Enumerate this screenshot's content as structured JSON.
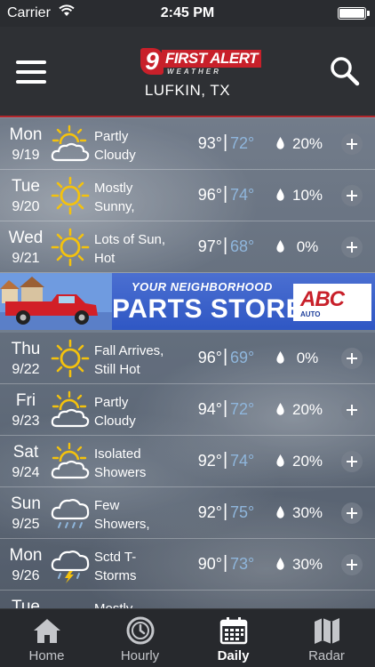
{
  "status_bar": {
    "carrier": "Carrier",
    "time": "2:45 PM"
  },
  "header": {
    "logo": {
      "number": "9",
      "text": "FIRST ALERT",
      "subtext": "WEATHER"
    },
    "location": "LUFKIN, TX"
  },
  "forecast": [
    {
      "day": "Mon",
      "date": "9/19",
      "icon": "partly-cloudy-icon",
      "desc1": "Partly",
      "desc2": "Cloudy",
      "hi": "93°",
      "lo": "72°",
      "precip": "20%"
    },
    {
      "day": "Tue",
      "date": "9/20",
      "icon": "sunny-icon",
      "desc1": "Mostly",
      "desc2": "Sunny,",
      "hi": "96°",
      "lo": "74°",
      "precip": "10%"
    },
    {
      "day": "Wed",
      "date": "9/21",
      "icon": "sunny-icon",
      "desc1": "Lots of Sun,",
      "desc2": "Hot",
      "hi": "97°",
      "lo": "68°",
      "precip": "0%"
    },
    {
      "day": "Thu",
      "date": "9/22",
      "icon": "sunny-icon",
      "desc1": "Fall Arrives,",
      "desc2": "Still Hot",
      "hi": "96°",
      "lo": "69°",
      "precip": "0%"
    },
    {
      "day": "Fri",
      "date": "9/23",
      "icon": "partly-cloudy-icon",
      "desc1": "Partly",
      "desc2": "Cloudy",
      "hi": "94°",
      "lo": "72°",
      "precip": "20%"
    },
    {
      "day": "Sat",
      "date": "9/24",
      "icon": "partly-cloudy-icon",
      "desc1": "Isolated",
      "desc2": "Showers",
      "hi": "92°",
      "lo": "74°",
      "precip": "20%"
    },
    {
      "day": "Sun",
      "date": "9/25",
      "icon": "showers-icon",
      "desc1": "Few",
      "desc2": "Showers,",
      "hi": "92°",
      "lo": "75°",
      "precip": "30%"
    },
    {
      "day": "Mon",
      "date": "9/26",
      "icon": "thunderstorm-icon",
      "desc1": "Sctd T-",
      "desc2": "Storms",
      "hi": "90°",
      "lo": "73°",
      "precip": "30%"
    },
    {
      "day": "Tue",
      "date": "",
      "icon": "",
      "desc1": "Mostly",
      "desc2": "",
      "hi": "",
      "lo": "",
      "precip": ""
    }
  ],
  "ad": {
    "tagline": "YOUR NEIGHBORHOOD",
    "headline": "PARTS STORE",
    "brand": "ABC",
    "brand_sub": "AUTO"
  },
  "tabs": [
    {
      "label": "Home",
      "icon": "home-icon"
    },
    {
      "label": "Hourly",
      "icon": "clock-icon"
    },
    {
      "label": "Daily",
      "icon": "calendar-icon",
      "active": true
    },
    {
      "label": "Radar",
      "icon": "map-icon"
    }
  ],
  "colors": {
    "header_bg": "#2e3034",
    "accent_red": "#b3262b",
    "low_temp": "#8fb6dc",
    "tabbar_bg": "#27292d"
  }
}
